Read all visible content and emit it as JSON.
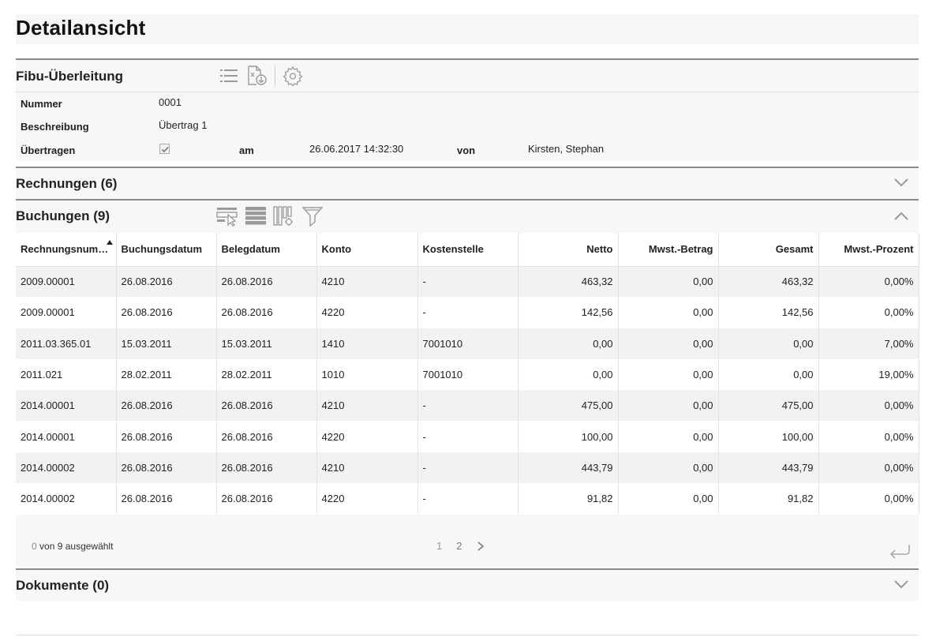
{
  "page": {
    "title": "Detailansicht"
  },
  "fibu": {
    "title": "Fibu-Überleitung",
    "icons": [
      "list-icon",
      "export-document-icon",
      "settings-gear-icon"
    ],
    "nummer_label": "Nummer",
    "nummer": "0001",
    "beschreibung_label": "Beschreibung",
    "beschreibung": "Übertrag 1",
    "uebertragen_label": "Übertragen",
    "uebertragen_checked": true,
    "am_label": "am",
    "am": "26.06.2017 14:32:30",
    "von_label": "von",
    "von": "Kirsten, Stephan"
  },
  "rechnungen": {
    "title": "Rechnungen (6)",
    "expanded": false
  },
  "buchungen": {
    "title": "Buchungen (9)",
    "expanded": true,
    "icons": [
      "row-select-icon",
      "list-density-icon",
      "column-settings-icon",
      "filter-icon"
    ],
    "columns": [
      "Rechnungsnum…",
      "Buchungsdatum",
      "Belegdatum",
      "Konto",
      "Kostenstelle",
      "Netto",
      "Mwst.-Betrag",
      "Gesamt",
      "Mwst.-Prozent"
    ],
    "sort_column": "Rechnungsnum…",
    "rows": [
      [
        "2009.00001",
        "26.08.2016",
        "26.08.2016",
        "4210",
        "-",
        "463,32",
        "0,00",
        "463,32",
        "0,00%"
      ],
      [
        "2009.00001",
        "26.08.2016",
        "26.08.2016",
        "4220",
        "-",
        "142,56",
        "0,00",
        "142,56",
        "0,00%"
      ],
      [
        "2011.03.365.01",
        "15.03.2011",
        "15.03.2011",
        "1410",
        "7001010",
        "0,00",
        "0,00",
        "0,00",
        "7,00%"
      ],
      [
        "2011.021",
        "28.02.2011",
        "28.02.2011",
        "1010",
        "7001010",
        "0,00",
        "0,00",
        "0,00",
        "19,00%"
      ],
      [
        "2014.00001",
        "26.08.2016",
        "26.08.2016",
        "4210",
        "-",
        "475,00",
        "0,00",
        "475,00",
        "0,00%"
      ],
      [
        "2014.00001",
        "26.08.2016",
        "26.08.2016",
        "4220",
        "-",
        "100,00",
        "0,00",
        "100,00",
        "0,00%"
      ],
      [
        "2014.00002",
        "26.08.2016",
        "26.08.2016",
        "4210",
        "-",
        "443,79",
        "0,00",
        "443,79",
        "0,00%"
      ],
      [
        "2014.00002",
        "26.08.2016",
        "26.08.2016",
        "4220",
        "-",
        "91,82",
        "0,00",
        "91,82",
        "0,00%"
      ]
    ],
    "selected_count": "0",
    "selection_text": "von 9 ausgewählt",
    "pages": [
      "1",
      "2"
    ],
    "current_page": "1"
  },
  "dokumente": {
    "title": "Dokumente (0)",
    "expanded": false
  },
  "colors": {
    "accent": "#8a8a8a",
    "row_alt": "#f2f2f2",
    "panel": "#f7f7f7",
    "icon": "#9a9a9a"
  }
}
